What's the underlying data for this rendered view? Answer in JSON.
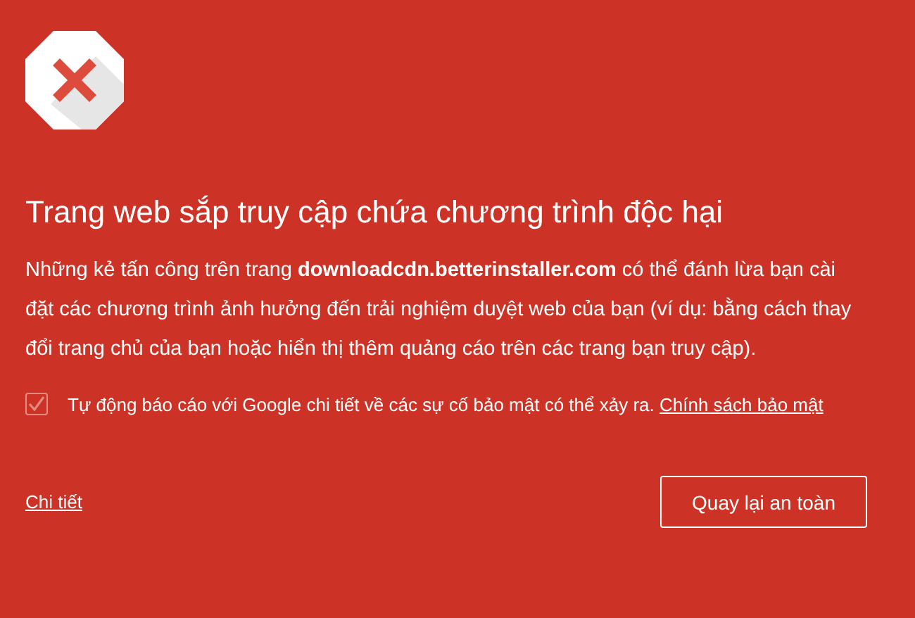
{
  "title": "Trang web sắp truy cập chứa chương trình độc hại",
  "message": "Những kẻ tấn công trên trang **downloadcdn.betterinstaller.com** có thể đánh lừa bạn cài đặt các chương trình ảnh hưởng đến trải nghiệm duyệt web của bạn (ví dụ: bằng cách thay đổi trang chủ của bạn hoặc hiển thị thêm quảng cáo trên các trang bạn truy cập).",
  "report": {
    "checked": true,
    "label": "Tự động báo cáo với Google chi tiết về các sự cố bảo mật có thể xảy ra.",
    "link": "Chính sách bảo mật"
  },
  "details_link": "Chi tiết",
  "back_button": "Quay lại an toàn"
}
